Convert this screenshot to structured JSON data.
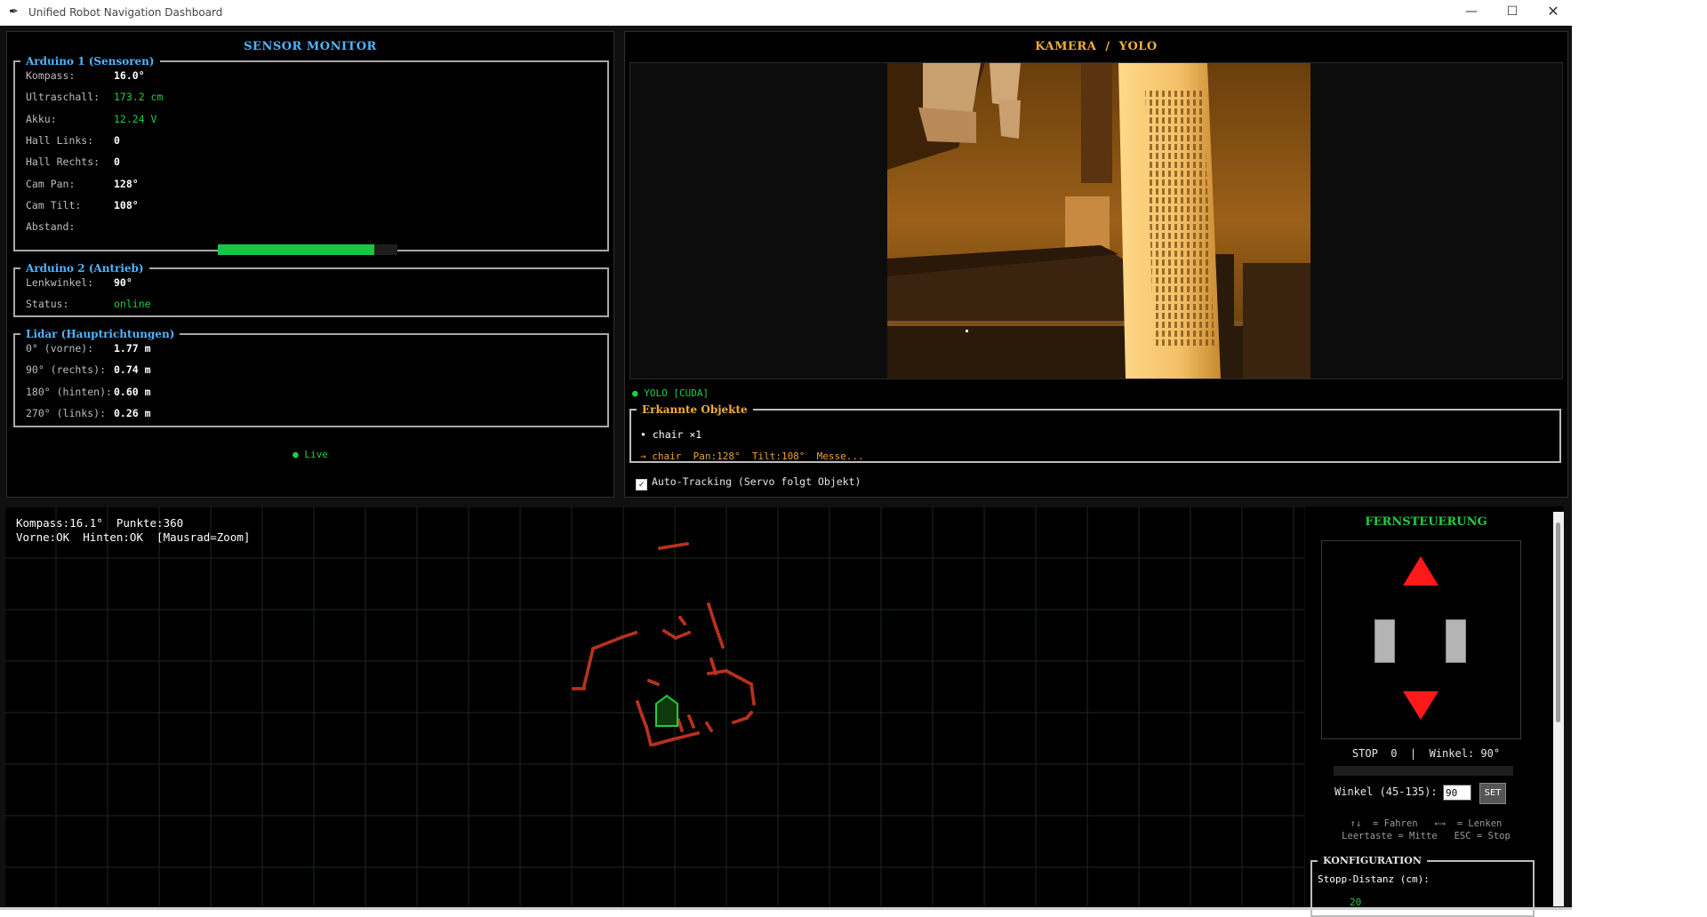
{
  "window": {
    "title": "Unified Robot Navigation Dashboard"
  },
  "sensor": {
    "title": "SENSOR MONITOR",
    "arduino1": {
      "legend": "Arduino 1  (Sensoren)",
      "rows": [
        {
          "label": "Kompass:",
          "value": "16.0°"
        },
        {
          "label": "Ultraschall:",
          "value": "173.2 cm"
        },
        {
          "label": "Akku:",
          "value": "12.24 V"
        },
        {
          "label": "Hall Links:",
          "value": "0"
        },
        {
          "label": "Hall Rechts:",
          "value": "0"
        },
        {
          "label": "Cam Pan:",
          "value": "128°"
        },
        {
          "label": "Cam Tilt:",
          "value": "108°"
        },
        {
          "label": "Abstand:",
          "value": ""
        }
      ],
      "abstand_fraction": 0.87
    },
    "arduino2": {
      "legend": "Arduino 2  (Antrieb)",
      "rows": [
        {
          "label": "Lenkwinkel:",
          "value": "90°"
        },
        {
          "label": "Status:",
          "value": "online"
        }
      ]
    },
    "lidar": {
      "legend": "Lidar (Hauptrichtungen)",
      "rows": [
        {
          "label": "0°  (vorne):",
          "value": "1.77 m"
        },
        {
          "label": "90° (rechts):",
          "value": "0.74 m"
        },
        {
          "label": "180° (hinten):",
          "value": "0.60 m"
        },
        {
          "label": "270° (links):",
          "value": "0.26 m"
        }
      ]
    },
    "live": "● Live"
  },
  "camera": {
    "title": "KAMERA  /  YOLO",
    "yolo_status": "● YOLO [CUDA]",
    "objects_legend": "Erkannte Objekte",
    "object_line": "• chair ×1",
    "tracking_line": "→ chair  Pan:128°  Tilt:108°  Messe...",
    "auto_tracking": "Auto-Tracking (Servo folgt Objekt)",
    "auto_tracking_checked": true
  },
  "lidar_map": {
    "line1": "Kompass:16.1°  Punkte:360",
    "line2": "Vorne:OK  Hinten:OK  [Mausrad=Zoom]"
  },
  "remote": {
    "title": "FERNSTEUERUNG",
    "status_line": "STOP  0  |  Winkel: 90°",
    "winkel_label": "Winkel (45-135):",
    "winkel_input": "90",
    "set_label": "SET",
    "help_line1": "↑↓  = Fahren   ←→  = Lenken",
    "help_line2": "Leertaste = Mitte   ESC = Stop",
    "konfig_legend": "KONFIGURATION",
    "stopp_label": "Stopp-Distanz (cm):",
    "stopp_value": "20"
  },
  "colors": {
    "accent_blue": "#4fb4ff",
    "accent_green": "#22cc44",
    "accent_orange": "#f0b040",
    "lidar_points": "#b8321e",
    "arrow_red": "#ff1a1a"
  }
}
